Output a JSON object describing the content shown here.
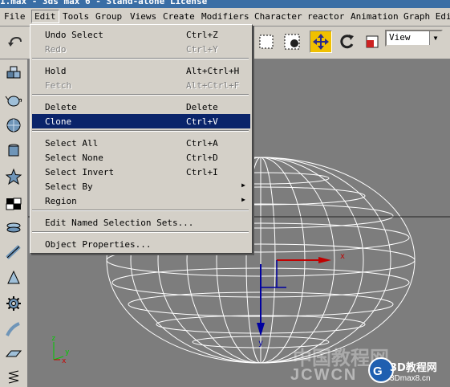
{
  "title": "1.max - 3ds max 6 - Stand-alone License",
  "menubar": [
    "File",
    "Edit",
    "Tools",
    "Group",
    "Views",
    "Create",
    "Modifiers",
    "Character",
    "reactor",
    "Animation",
    "Graph Edit"
  ],
  "toolbar": {
    "view_select": "View"
  },
  "edit_menu": {
    "items": [
      {
        "label": "Undo Select",
        "shortcut": "Ctrl+Z",
        "state": "enabled"
      },
      {
        "label": "Redo",
        "shortcut": "Ctrl+Y",
        "state": "disabled"
      },
      {
        "label": "Hold",
        "shortcut": "Alt+Ctrl+H",
        "state": "enabled"
      },
      {
        "label": "Fetch",
        "shortcut": "Alt+Ctrl+F",
        "state": "disabled"
      },
      {
        "label": "Delete",
        "shortcut": "Delete",
        "state": "enabled"
      },
      {
        "label": "Clone",
        "shortcut": "Ctrl+V",
        "state": "highlighted"
      },
      {
        "label": "Select All",
        "shortcut": "Ctrl+A",
        "state": "enabled"
      },
      {
        "label": "Select None",
        "shortcut": "Ctrl+D",
        "state": "enabled"
      },
      {
        "label": "Select Invert",
        "shortcut": "Ctrl+I",
        "state": "enabled"
      },
      {
        "label": "Select By",
        "shortcut": "",
        "state": "submenu"
      },
      {
        "label": "Region",
        "shortcut": "",
        "state": "submenu"
      },
      {
        "label": "Edit Named Selection Sets...",
        "shortcut": "",
        "state": "enabled"
      },
      {
        "label": "Object Properties...",
        "shortcut": "",
        "state": "enabled"
      }
    ]
  },
  "viewport": {
    "axis_x": "x",
    "axis_y": "y",
    "axis_z": "z",
    "gizmo_x": "x",
    "gizmo_y": "y"
  },
  "watermark": {
    "cn": "中国教程网",
    "logo": "JCWCN",
    "site_cn": "3D教程网",
    "site": "3Dmax8.cn"
  },
  "colors": {
    "menu_bg": "#d4d0c8",
    "highlight": "#0a246a",
    "viewport": "#7d7d7d",
    "active_tool": "#f0c000"
  },
  "icons": {
    "toolbar": [
      "undo-icon",
      "select-region-icon",
      "select-object-icon",
      "move-icon",
      "rotate-icon",
      "scale-icon"
    ],
    "left": [
      "box-icon",
      "teapot-icon",
      "sphere-icon",
      "cylinder-icon",
      "star-icon",
      "checker-icon",
      "torus-icon",
      "tube-icon",
      "pyramid-icon",
      "gear-icon",
      "hose-icon",
      "plane-icon",
      "spring-icon"
    ]
  }
}
